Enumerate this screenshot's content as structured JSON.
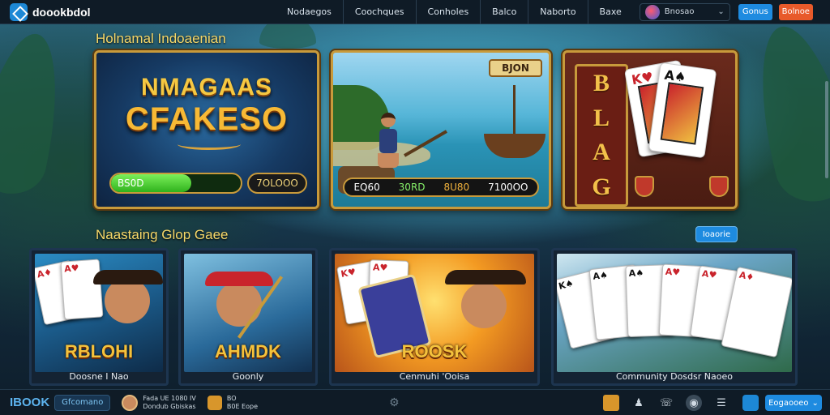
{
  "header": {
    "brand": "doookbdol",
    "nav": [
      "Nodaegos",
      "Coochques",
      "Conholes",
      "Balco",
      "Naborto",
      "Baxe"
    ],
    "user": {
      "name": "Bnosao"
    },
    "login_label": "Gonus",
    "join_label": "Bolnoe"
  },
  "featured": {
    "title": "Holnamal Indoaenian",
    "tiles": [
      {
        "title_line1": "NMAGAAS",
        "title_line2": "CFAKESO",
        "left_value": "BS0D",
        "right_value": "7OLOOO",
        "progress": 0.62
      },
      {
        "sign": "BJON",
        "v1": "EQ60",
        "v2": "30RD",
        "v3": "8U80",
        "v4": "7100OO"
      },
      {
        "letters": [
          "B",
          "L",
          "A",
          "G"
        ]
      }
    ]
  },
  "more_games": {
    "title": "Naastaing Glop Gaee",
    "button_label": "Ioaorie",
    "games": [
      {
        "art_title": "RBLOHI",
        "label": "Doosne I Nao"
      },
      {
        "art_title": "AHMDK",
        "label": "Goonly"
      },
      {
        "art_title": "ROOSK",
        "label": "Cenmuhi 'Ooisa"
      },
      {
        "art_title": "",
        "label": "Community Dosdsr Naoeo"
      }
    ]
  },
  "footer": {
    "brand": "IBOOK",
    "badge": "Gfcomano",
    "user_line1": "Fada UE 1080 IV",
    "user_line2": "Dondub Gbiskas",
    "coin_line1": "BO",
    "coin_line2": "B0E Eope",
    "center_icon": "bot-icon",
    "lang_label": "Eogaooeo"
  },
  "colors": {
    "accent": "#1e8be0",
    "gold": "#c89a3b",
    "join": "#e85a2a"
  }
}
